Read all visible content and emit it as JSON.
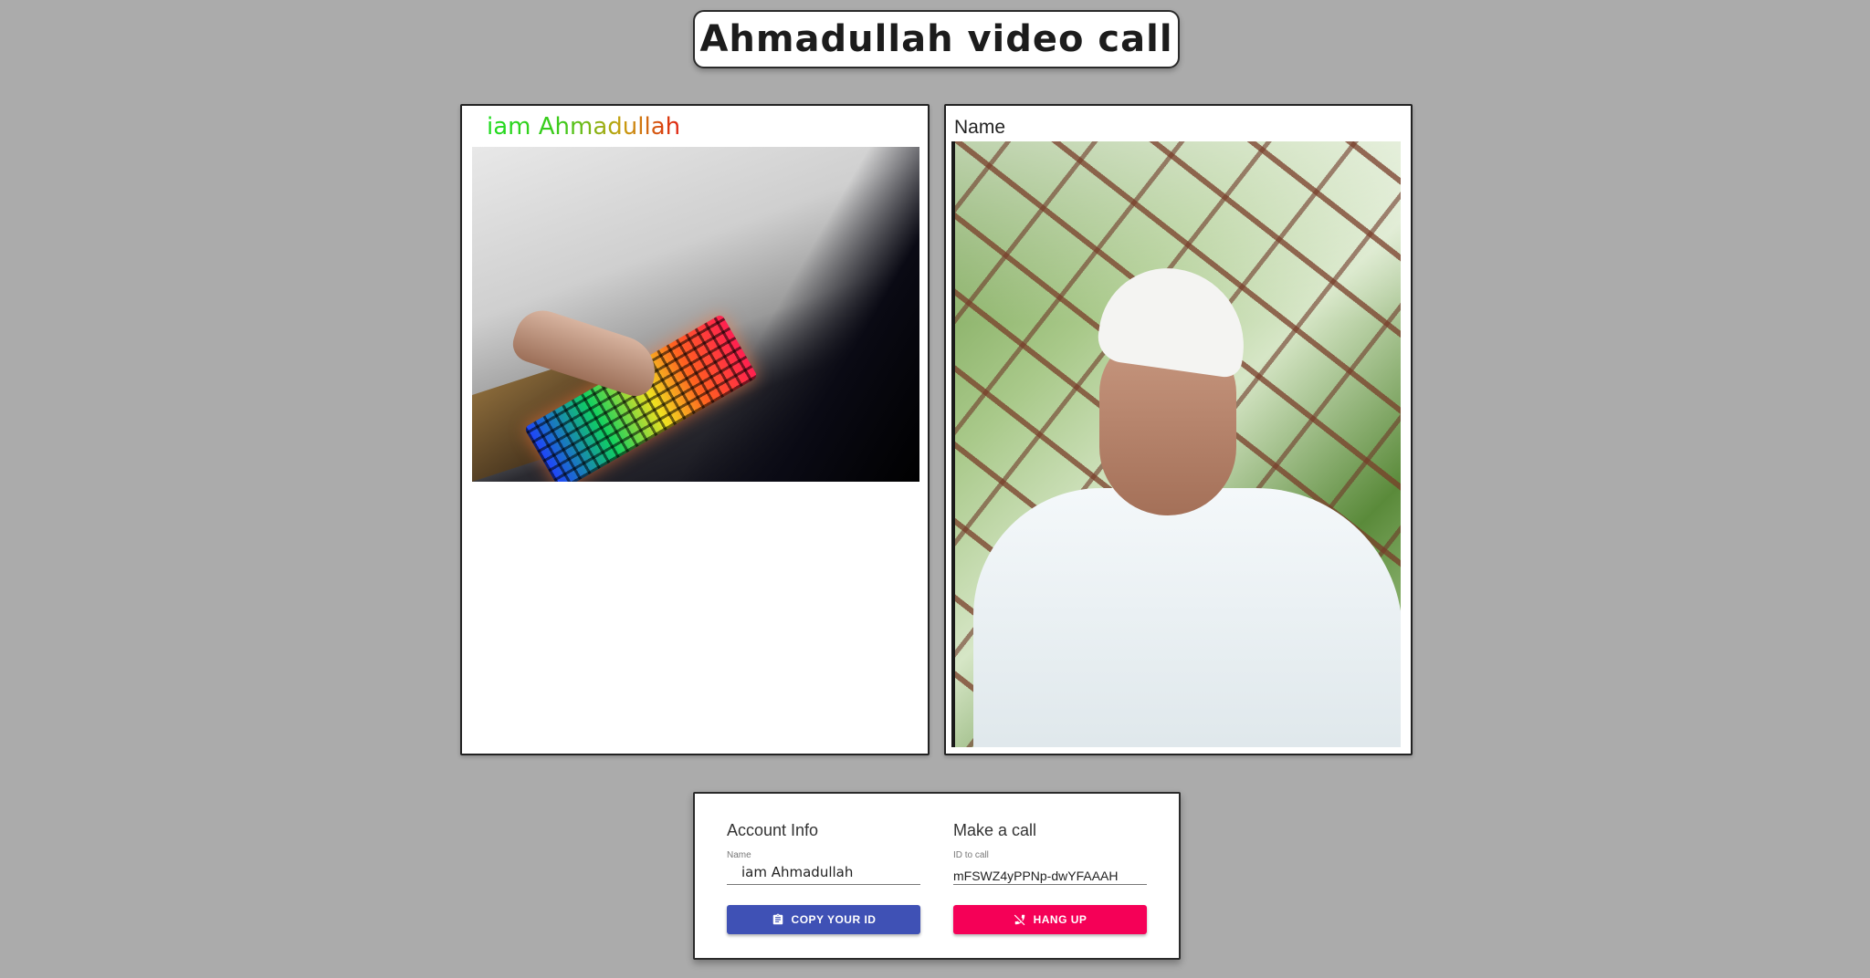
{
  "header": {
    "title": "Ahmadullah video call"
  },
  "local_video": {
    "label": "iam Ahmadullah"
  },
  "remote_video": {
    "label": "Name"
  },
  "controls": {
    "account": {
      "heading": "Account Info",
      "name_label": "Name",
      "name_value": "iam Ahmadullah",
      "copy_button": "COPY YOUR ID",
      "copy_icon": "clipboard-icon"
    },
    "call": {
      "heading": "Make a call",
      "id_label": "ID to call",
      "id_value": "mFSWZ4yPPNp-dwYFAAAH",
      "hangup_button": "HANG UP",
      "hangup_icon": "phone-disabled-icon"
    },
    "colors": {
      "copy_button": "#3f51b5",
      "hangup_button": "#f50057",
      "background": "#ababab"
    }
  }
}
